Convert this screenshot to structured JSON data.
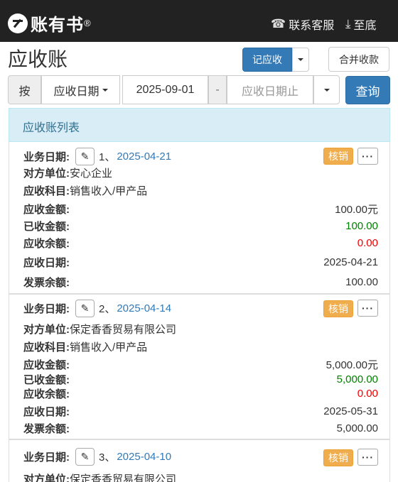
{
  "header": {
    "logo_text": "账有书",
    "logo_reg": "®",
    "service_label": "联系客服",
    "bottom_label": "至底"
  },
  "page": {
    "title": "应收账",
    "record_button": "记应收",
    "merge_button": "合并收款"
  },
  "filter": {
    "by_label": "按",
    "date_type": "应收日期",
    "start_date": "2025-09-01",
    "dash": "-",
    "end_placeholder": "应收日期止",
    "query_button": "查询"
  },
  "list": {
    "header": "应收账列表",
    "labels": {
      "business_date": "业务日期:",
      "counterparty": "对方单位:",
      "account": "应收科目:",
      "amount_due": "应收金额:",
      "amount_received": "已收金额:",
      "balance": "应收余额:",
      "due_date": "应收日期:",
      "invoice_balance": "发票余额:"
    },
    "verify_label": "核销",
    "items": [
      {
        "seq": "1、",
        "business_date": "2025-04-21",
        "counterparty": "安心企业",
        "account": "销售收入/甲产品",
        "amount_due": "100.00元",
        "amount_received": "100.00",
        "balance": "0.00",
        "due_date": "2025-04-21",
        "invoice_balance": "100.00"
      },
      {
        "seq": "2、",
        "business_date": "2025-04-14",
        "counterparty": "保定香香贸易有限公司",
        "account": "销售收入/甲产品",
        "amount_due": "5,000.00元",
        "amount_received": "5,000.00",
        "balance": "0.00",
        "due_date": "2025-05-31",
        "invoice_balance": "5,000.00"
      },
      {
        "seq": "3、",
        "business_date": "2025-04-10",
        "counterparty": "保定香香贸易有限公司"
      }
    ]
  }
}
